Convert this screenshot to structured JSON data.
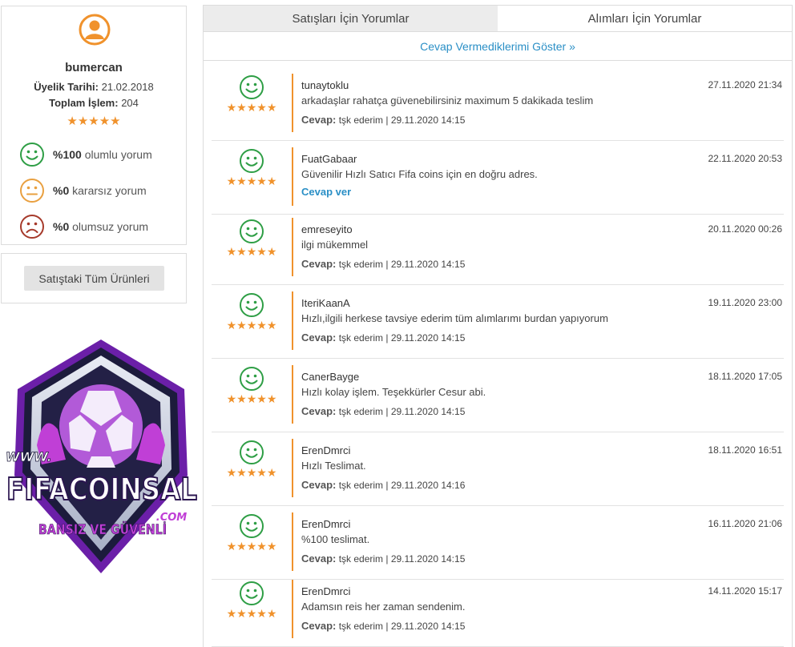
{
  "profile": {
    "username": "bumercan",
    "member_since_label": "Üyelik Tarihi:",
    "member_since": "21.02.2018",
    "total_label": "Toplam İşlem:",
    "total": "204",
    "stars": "★★★★★",
    "ratings": [
      {
        "percent": "%100",
        "label": "olumlu yorum",
        "icon": "happy-smiley-icon",
        "color": "#2e9e45"
      },
      {
        "percent": "%0",
        "label": "kararsız yorum",
        "icon": "neutral-smiley-icon",
        "color": "#e9a040"
      },
      {
        "percent": "%0",
        "label": "olumsuz yorum",
        "icon": "sad-smiley-icon",
        "color": "#a63a2b"
      }
    ]
  },
  "products_button": "Satıştaki Tüm Ürünleri",
  "logo": {
    "www": "WWW.",
    "name": "FIFACOINSAL",
    "com": ".COM",
    "slogan": "BANSIZ VE GÜVENLİ"
  },
  "tabs": [
    {
      "label": "Satışları İçin Yorumlar",
      "active": true
    },
    {
      "label": "Alımları İçin Yorumlar",
      "active": false
    }
  ],
  "show_unanswered": "Cevap Vermediklerimi Göster »",
  "reply_label": "Cevap:",
  "reply_link": "Cevap ver",
  "colors": {
    "accent": "#f0922c",
    "link": "#2a8fc6",
    "positive": "#2e9e45"
  },
  "reviews": [
    {
      "user": "tunaytoklu",
      "date": "27.11.2020 21:34",
      "text": "arkadaşlar rahatça güvenebilirsiniz maximum 5 dakikada teslim",
      "stars": "★★★★★",
      "reply": "tşk ederim | 29.11.2020 14:15"
    },
    {
      "user": "FuatGabaar",
      "date": "22.11.2020 20:53",
      "text": "Güvenilir Hızlı Satıcı Fifa coins için en doğru adres.",
      "stars": "★★★★★",
      "reply": ""
    },
    {
      "user": "emreseyito",
      "date": "20.11.2020 00:26",
      "text": "ilgi mükemmel",
      "stars": "★★★★★",
      "reply": "tşk ederim | 29.11.2020 14:15"
    },
    {
      "user": "IteriKaanA",
      "date": "19.11.2020 23:00",
      "text": "Hızlı,ilgili herkese tavsiye ederim tüm alımlarımı burdan yapıyorum",
      "stars": "★★★★★",
      "reply": "tşk ederim | 29.11.2020 14:15"
    },
    {
      "user": "CanerBayge",
      "date": "18.11.2020 17:05",
      "text": "Hızlı kolay işlem. Teşekkürler Cesur abi.",
      "stars": "★★★★★",
      "reply": "tşk ederim | 29.11.2020 14:15"
    },
    {
      "user": "ErenDmrci",
      "date": "18.11.2020 16:51",
      "text": "Hızlı Teslimat.",
      "stars": "★★★★★",
      "reply": "tşk ederim | 29.11.2020 14:16"
    },
    {
      "user": "ErenDmrci",
      "date": "16.11.2020 21:06",
      "text": "%100 teslimat.",
      "stars": "★★★★★",
      "reply": "tşk ederim | 29.11.2020 14:15"
    },
    {
      "user": "ErenDmrci",
      "date": "14.11.2020 15:17",
      "text": "Adamsın reis her zaman sendenim.",
      "stars": "★★★★★",
      "reply": "tşk ederim | 29.11.2020 14:15"
    }
  ]
}
